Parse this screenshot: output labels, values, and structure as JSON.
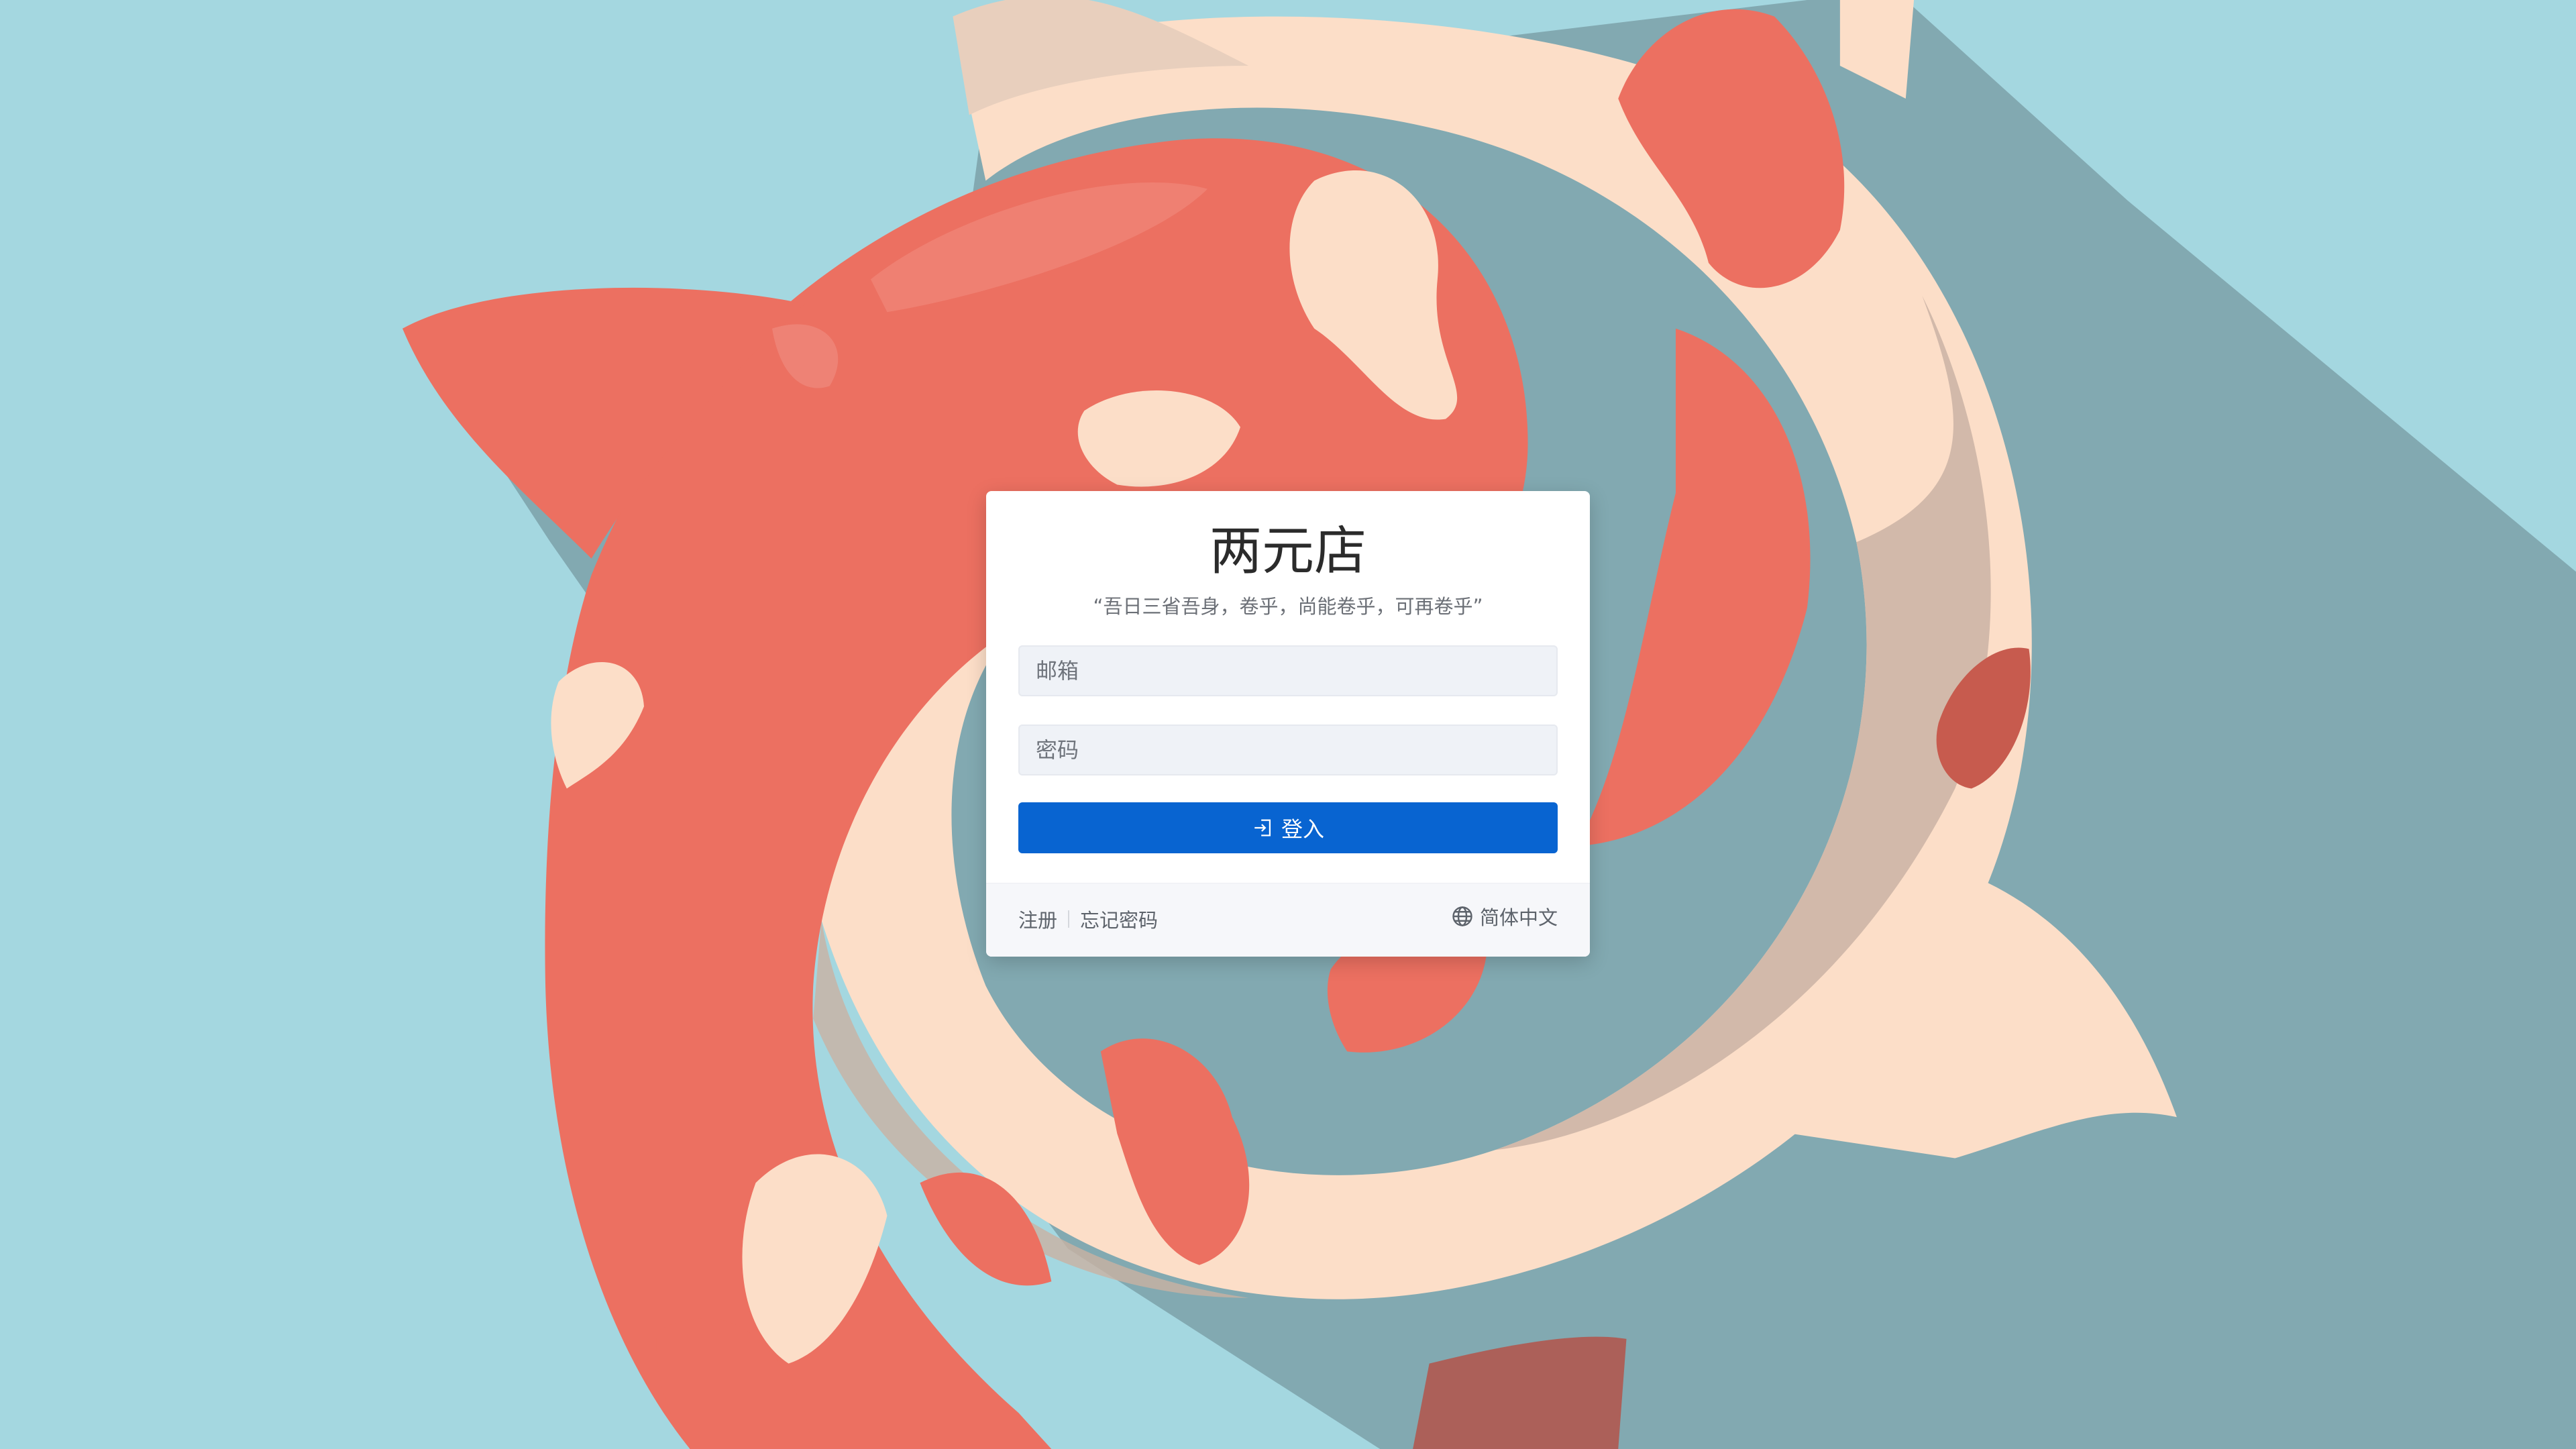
{
  "colors": {
    "background": "#a4d7e0",
    "shadow": "#82a9b1",
    "koi_red": "#ec7061",
    "koi_cream": "#fcdec8",
    "button": "#0864d1"
  },
  "login": {
    "title": "两元店",
    "motto": "“吾日三省吾身，卷乎，尚能卷乎，可再卷乎”",
    "email_placeholder": "邮箱",
    "password_placeholder": "密码",
    "login_icon": "login-icon",
    "login_label": "登入"
  },
  "footer": {
    "register_label": "注册",
    "forgot_label": "忘记密码",
    "language_icon": "globe-icon",
    "language_label": "简体中文"
  }
}
